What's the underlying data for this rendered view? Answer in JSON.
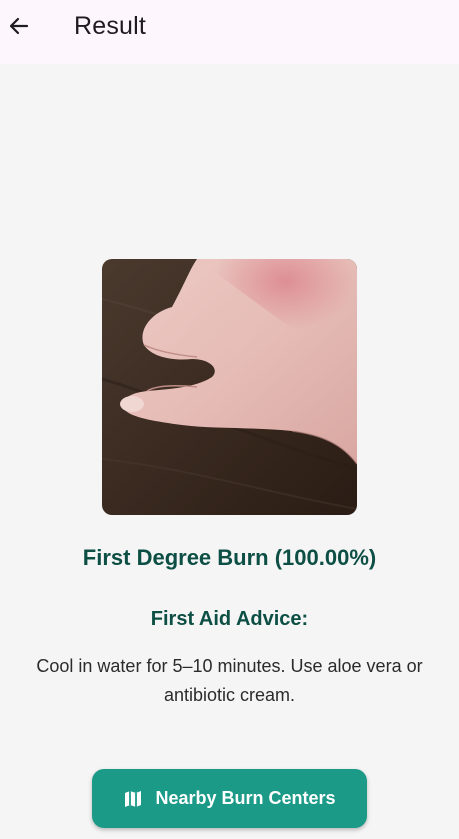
{
  "header": {
    "title": "Result",
    "back_icon": "arrow-left-icon"
  },
  "result": {
    "diagnosis": "First Degree Burn (100.00%)",
    "advice_heading": "First Aid Advice:",
    "advice_text": "Cool in water for 5–10 minutes. Use aloe vera or antibiotic cream."
  },
  "actions": {
    "nearby_label": "Nearby Burn Centers",
    "nearby_icon": "map-icon"
  },
  "colors": {
    "accent": "#1a9a87",
    "heading": "#0d4f44",
    "appbar": "#fdf6fd",
    "background": "#f5f5f5"
  }
}
